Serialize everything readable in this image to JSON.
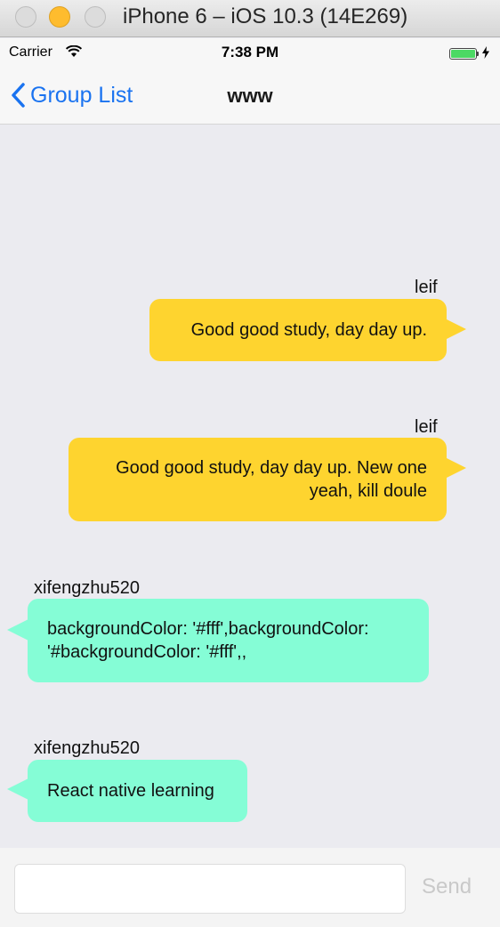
{
  "window": {
    "title": "iPhone 6 – iOS 10.3 (14E269)"
  },
  "status_bar": {
    "carrier": "Carrier",
    "time": "7:38 PM",
    "battery_level": 1.0,
    "battery_color": "#4cd964"
  },
  "nav": {
    "back_label": "Group List",
    "title": "www",
    "accent_color": "#1a73f0"
  },
  "messages": [
    {
      "user": "leif",
      "side": "right",
      "lines": [
        "Good good study, day day up."
      ],
      "color": "#fed42f"
    },
    {
      "user": "leif",
      "side": "right",
      "lines": [
        "Good good study, day day up. New one",
        "yeah, kill doule"
      ],
      "color": "#fed42f"
    },
    {
      "user": "xifengzhu520",
      "side": "left",
      "lines": [
        "backgroundColor: '#fff',backgroundColor:",
        "'#backgroundColor: '#fff',,"
      ],
      "color": "#85fdd6"
    },
    {
      "user": "xifengzhu520",
      "side": "left",
      "lines": [
        "React native learning"
      ],
      "color": "#85fdd6"
    }
  ],
  "composer": {
    "value": "",
    "placeholder": "",
    "send_label": "Send"
  }
}
